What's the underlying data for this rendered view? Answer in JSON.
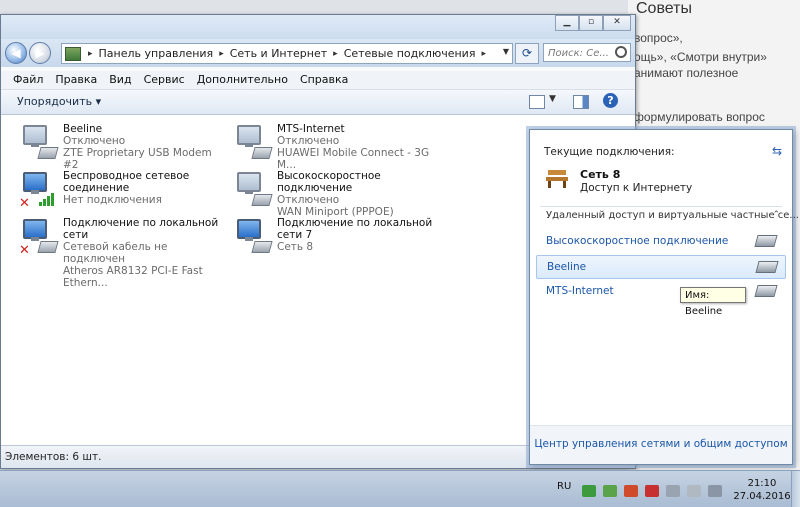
{
  "background_page": {
    "title": "Советы",
    "lines": [
      {
        "text": "вопрос»,"
      },
      {
        "text": "ощь», «Смотри внутри»"
      },
      {
        "text": "анимают полезное"
      },
      {
        "text": "формулировать вопрос"
      }
    ]
  },
  "window": {
    "breadcrumb": [
      "Панель управления",
      "Сеть и Интернет",
      "Сетевые подключения"
    ],
    "search_placeholder": "Поиск: Се...",
    "menu": [
      "Файл",
      "Правка",
      "Вид",
      "Сервис",
      "Дополнительно",
      "Справка"
    ],
    "organize_label": "Упорядочить",
    "status": "Элементов: 6 шт.",
    "connections": [
      {
        "name": "Beeline",
        "status": "Отключено",
        "device": "ZTE Proprietary USB Modem #2",
        "icon": "modem-icon",
        "badge": "modem"
      },
      {
        "name": "MTS-Internet",
        "status": "Отключено",
        "device": "HUAWEI Mobile Connect - 3G M...",
        "icon": "modem-icon",
        "badge": "modem"
      },
      {
        "name": "Беспроводное сетевое соединение",
        "status": "Нет подключения",
        "device": "",
        "icon": "wireless-icon",
        "badge": "bars"
      },
      {
        "name": "Высокоскоростное подключение",
        "status": "Отключено",
        "device": "WAN Miniport (PPPOE)",
        "icon": "pppoe-icon",
        "badge": "modem"
      },
      {
        "name": "Подключение по локальной сети",
        "status": "Сетевой кабель не подключен",
        "device": "Atheros AR8132 PCI-E Fast Ethern...",
        "icon": "lan-icon",
        "badge": "cable"
      },
      {
        "name": "Подключение по локальной сети 7",
        "status": "Сеть 8",
        "device": "",
        "icon": "lan-icon",
        "badge": "cable"
      }
    ]
  },
  "flyout": {
    "header": "Текущие подключения:",
    "network_name": "Сеть 8",
    "network_access": "Доступ к Интернету",
    "section": "Удаленный доступ и виртуальные частные се...",
    "entries": [
      "Высокоскоростное подключение",
      "Beeline",
      "MTS-Internet"
    ],
    "tooltip": "Имя: Beeline",
    "footer_link": "Центр управления сетями и общим доступом"
  },
  "taskbar": {
    "language": "RU",
    "time": "21:10",
    "date": "27.04.2016"
  },
  "colors": {
    "accent": "#1a56a8",
    "error": "#d2231f"
  }
}
